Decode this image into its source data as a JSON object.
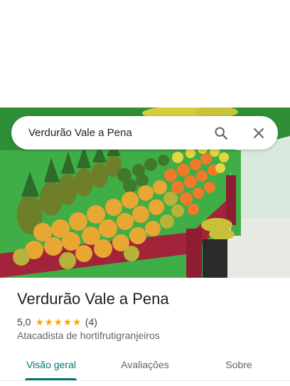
{
  "search": {
    "query": "Verdurão Vale a Pena",
    "search_icon": "search-icon",
    "close_icon": "close-icon"
  },
  "hero_image": {
    "description_icon": "storefront-photo"
  },
  "place": {
    "name": "Verdurão Vale a Pena",
    "rating": "5,0",
    "stars": 5,
    "review_count": "(4)",
    "category": "Atacadista de hortifrutigranjeiros"
  },
  "tabs": [
    {
      "label": "Visão geral",
      "active": true
    },
    {
      "label": "Avaliações",
      "active": false
    },
    {
      "label": "Sobre",
      "active": false
    }
  ],
  "colors": {
    "accent": "#00796b",
    "star": "#f9ab00",
    "text": "#202124",
    "secondary_text": "#5f6368"
  }
}
